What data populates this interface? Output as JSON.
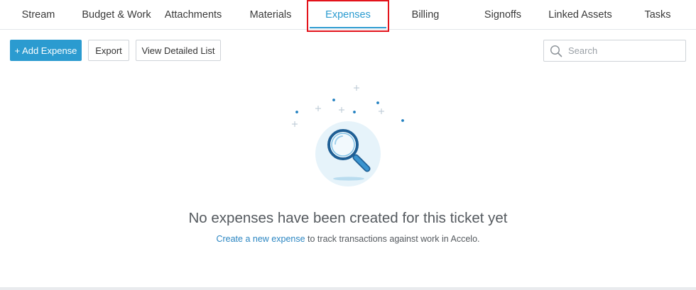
{
  "tabs": [
    {
      "label": "Stream"
    },
    {
      "label": "Budget & Work"
    },
    {
      "label": "Attachments"
    },
    {
      "label": "Materials"
    },
    {
      "label": "Expenses",
      "active": true
    },
    {
      "label": "Billing"
    },
    {
      "label": "Signoffs"
    },
    {
      "label": "Linked Assets"
    },
    {
      "label": "Tasks"
    }
  ],
  "toolbar": {
    "add_expense_label": "+ Add Expense",
    "export_label": "Export",
    "detailed_list_label": "View Detailed List"
  },
  "search": {
    "placeholder": "Search",
    "value": "",
    "icon": "search-icon"
  },
  "empty_state": {
    "illustration_icon": "magnifying-glass-icon",
    "title": "No expenses have been created for this ticket yet",
    "link_text": "Create a new expense",
    "suffix_text": " to track transactions against work in Accelo."
  },
  "colors": {
    "accent": "#2b9bd0",
    "link": "#2b86c2",
    "highlight": "#e3131b"
  }
}
